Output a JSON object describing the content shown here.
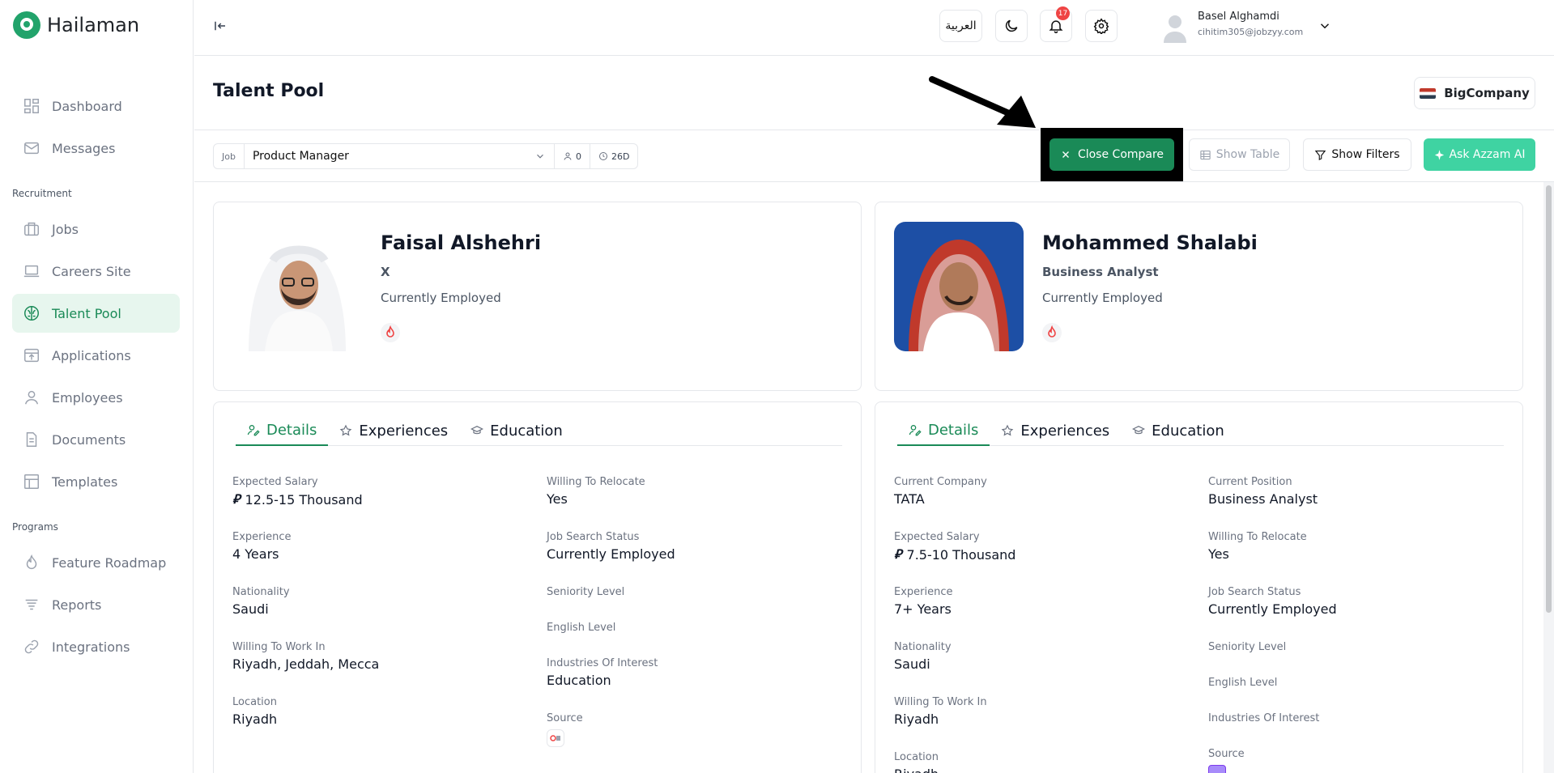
{
  "brand": {
    "name": "Hailaman"
  },
  "sidebar": {
    "items": [
      {
        "label": "Dashboard",
        "icon": "dashboard-icon"
      },
      {
        "label": "Messages",
        "icon": "mail-icon"
      }
    ],
    "recruitment_label": "Recruitment",
    "recruitment_items": [
      {
        "label": "Jobs",
        "icon": "briefcase-icon"
      },
      {
        "label": "Careers Site",
        "icon": "laptop-icon"
      },
      {
        "label": "Talent Pool",
        "icon": "brain-icon",
        "active": true
      },
      {
        "label": "Applications",
        "icon": "upload-icon"
      },
      {
        "label": "Employees",
        "icon": "user-icon"
      },
      {
        "label": "Documents",
        "icon": "document-icon"
      },
      {
        "label": "Templates",
        "icon": "template-icon"
      }
    ],
    "programs_label": "Programs",
    "programs_items": [
      {
        "label": "Feature Roadmap",
        "icon": "flame-icon"
      },
      {
        "label": "Reports",
        "icon": "filter-lines-icon"
      },
      {
        "label": "Integrations",
        "icon": "link-icon"
      }
    ]
  },
  "topbar": {
    "language": "العربية",
    "notifications_count": "17",
    "user_name": "Basel Alghamdi",
    "user_email": "cihitim305@jobzyy.com"
  },
  "page": {
    "title": "Talent Pool",
    "company": "BigCompany"
  },
  "filters": {
    "job_label": "Job",
    "job_value": "Product Manager",
    "applicants_count": "0",
    "days": "26D",
    "close_compare": "Close Compare",
    "show_table": "Show Table",
    "show_filters": "Show Filters",
    "ask_ai": "Ask Azzam AI"
  },
  "tabs": {
    "details": "Details",
    "experiences": "Experiences",
    "education": "Education"
  },
  "candidates": [
    {
      "name": "Faisal Alshehri",
      "role": "X",
      "status": "Currently Employed",
      "left_fields": [
        {
          "label": "Expected Salary",
          "value": "12.5-15 Thousand",
          "currency": true
        },
        {
          "label": "Experience",
          "value": "4 Years"
        },
        {
          "label": "Nationality",
          "value": "Saudi"
        },
        {
          "label": "Willing To Work In",
          "value": "Riyadh, Jeddah, Mecca"
        },
        {
          "label": "Location",
          "value": "Riyadh"
        }
      ],
      "right_fields": [
        {
          "label": "Willing To Relocate",
          "value": "Yes"
        },
        {
          "label": "Job Search Status",
          "value": "Currently Employed"
        },
        {
          "label": "Seniority Level",
          "value": ""
        },
        {
          "label": "English Level",
          "value": ""
        },
        {
          "label": "Industries Of Interest",
          "value": "Education"
        },
        {
          "label": "Source",
          "value": ""
        }
      ]
    },
    {
      "name": "Mohammed Shalabi",
      "role": "Business Analyst",
      "status": "Currently Employed",
      "left_fields": [
        {
          "label": "Current Company",
          "value": "TATA"
        },
        {
          "label": "Expected Salary",
          "value": "7.5-10 Thousand",
          "currency": true
        },
        {
          "label": "Experience",
          "value": "7+ Years"
        },
        {
          "label": "Nationality",
          "value": "Saudi"
        },
        {
          "label": "Willing To Work In",
          "value": "Riyadh"
        },
        {
          "label": "Location",
          "value": "Riyadh"
        }
      ],
      "right_fields": [
        {
          "label": "Current Position",
          "value": "Business Analyst"
        },
        {
          "label": "Willing To Relocate",
          "value": "Yes"
        },
        {
          "label": "Job Search Status",
          "value": "Currently Employed"
        },
        {
          "label": "Seniority Level",
          "value": ""
        },
        {
          "label": "English Level",
          "value": ""
        },
        {
          "label": "Industries Of Interest",
          "value": ""
        },
        {
          "label": "Source",
          "value": ""
        }
      ]
    }
  ],
  "colors": {
    "accent": "#1a8a57",
    "accent_light": "#e7f6ee",
    "ai_button": "#3fd3a2",
    "badge": "#ef4444"
  }
}
